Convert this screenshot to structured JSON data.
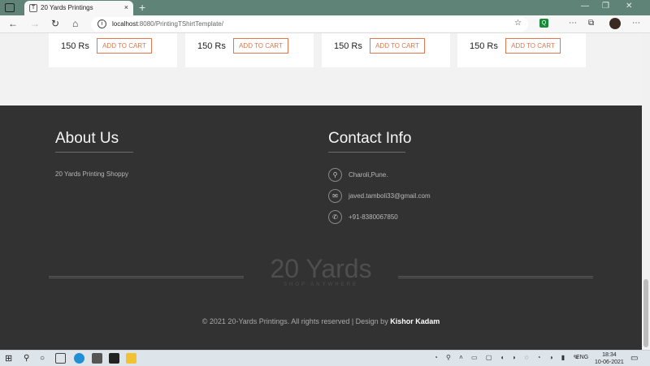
{
  "browser": {
    "tab_title": "20 Yards Printings",
    "tab_favicon": "T",
    "close_tab": "×",
    "new_tab": "+",
    "url_host": "localhost",
    "url_rest": ":8080/PrintingTShirtTemplate/",
    "back": "←",
    "forward": "→",
    "reload": "↻",
    "home": "⌂",
    "info": "i",
    "favorites": "☆",
    "extension_badge": "Q",
    "reading_list": "⋯",
    "collections": "⧉",
    "profile_menu": "⋯",
    "window_minimize": "—",
    "window_restore": "❐",
    "window_close": "✕"
  },
  "products": [
    {
      "price": "150 Rs",
      "button": "ADD TO CART"
    },
    {
      "price": "150 Rs",
      "button": "ADD TO CART"
    },
    {
      "price": "150 Rs",
      "button": "ADD TO CART"
    },
    {
      "price": "150 Rs",
      "button": "ADD TO CART"
    }
  ],
  "footer": {
    "about_title": "About Us",
    "about_text": "20 Yards Printing Shoppy",
    "contact_title": "Contact Info",
    "contact": [
      {
        "icon": "location-icon",
        "glyph": "⚲",
        "text": "Charoli,Pune."
      },
      {
        "icon": "mail-icon",
        "glyph": "✉",
        "text": "javed.tamboli33@gmail.com"
      },
      {
        "icon": "phone-icon",
        "glyph": "✆",
        "text": "+91-8380067850"
      }
    ],
    "logo_text": "20 Yards",
    "logo_tagline": "SHOP ANYWHERE",
    "copyright": "© 2021 20-Yards Printings. All rights reserved | Design by ",
    "designer": "Kishor Kadam"
  },
  "taskbar": {
    "start": "⊞",
    "search": "⚲",
    "taskview": "○",
    "language": "ENG",
    "time": "18:34",
    "date": "10-06-2021",
    "notifications": "▭"
  },
  "colors": {
    "accent": "#e0774f",
    "footer_bg": "#323232",
    "tabbar": "#5f8477"
  }
}
